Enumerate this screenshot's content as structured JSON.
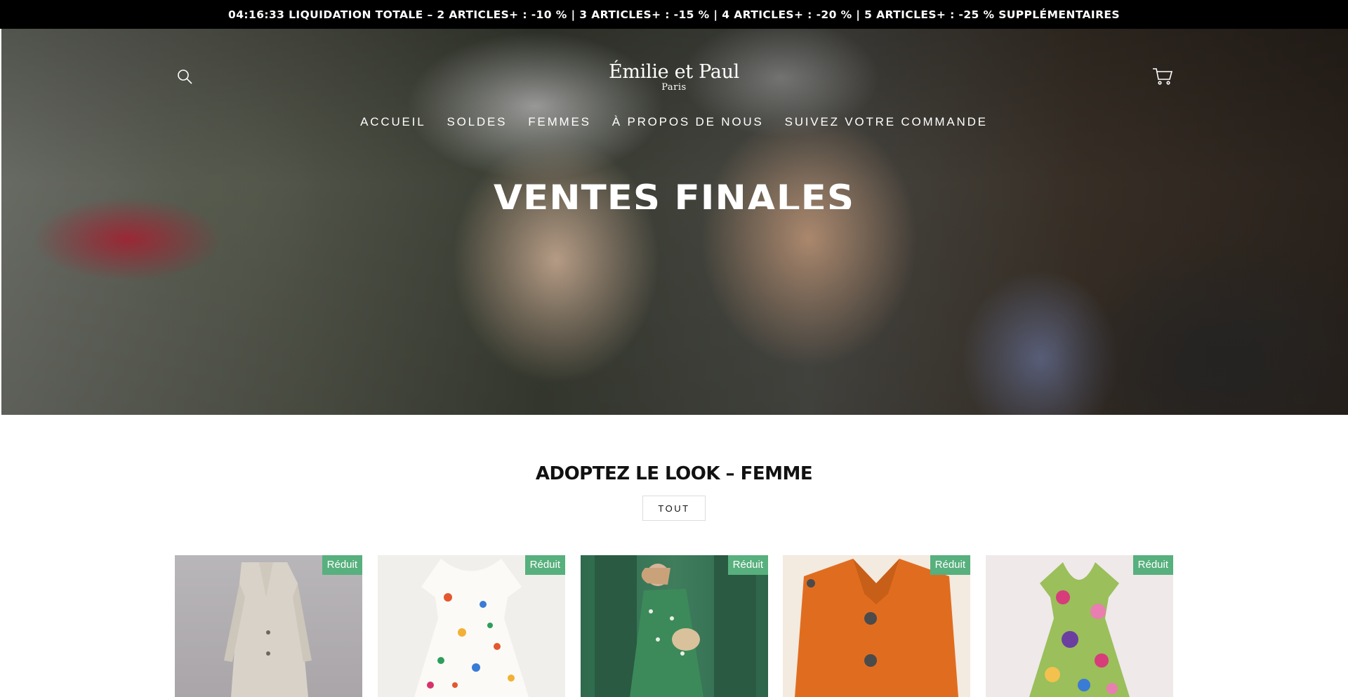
{
  "announcement": {
    "text": "04:16:33 LIQUIDATION TOTALE – 2 ARTICLES+ : -10 % | 3 ARTICLES+ : -15 % | 4 ARTICLES+ : -20 % | 5 ARTICLES+ : -25 % SUPPLÉMENTAIRES"
  },
  "header": {
    "logo_main": "Émilie et Paul",
    "logo_sub": "Paris",
    "search_icon": "search-icon",
    "cart_icon": "cart-icon",
    "nav": [
      {
        "label": "ACCUEIL"
      },
      {
        "label": "SOLDES"
      },
      {
        "label": "FEMMES"
      },
      {
        "label": "À PROPOS DE NOUS"
      },
      {
        "label": "SUIVEZ VOTRE COMMANDE"
      }
    ]
  },
  "hero": {
    "title": "VENTES FINALES"
  },
  "collection": {
    "title": "ADOPTEZ LE LOOK – FEMME",
    "button_label": "TOUT",
    "products": [
      {
        "badge": "Réduit",
        "image": "beige-wool-coat"
      },
      {
        "badge": "Réduit",
        "image": "floral-white-dress"
      },
      {
        "badge": "Réduit",
        "image": "green-patterned-dress"
      },
      {
        "badge": "Réduit",
        "image": "orange-knit-cardigan"
      },
      {
        "badge": "Réduit",
        "image": "colorful-floral-wrap-dress"
      }
    ]
  },
  "colors": {
    "announcement_bg": "#000000",
    "badge_bg": "#57b07d",
    "text_dark": "#111111"
  }
}
